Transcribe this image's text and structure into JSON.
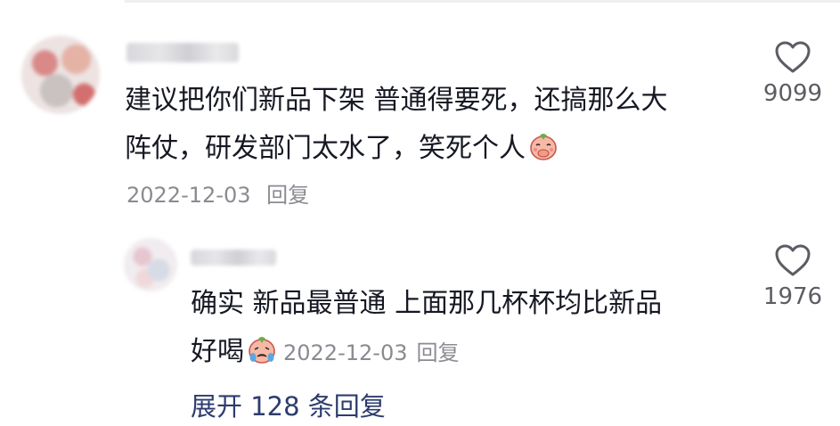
{
  "main_comment": {
    "text_line1": "建议把你们新品下架 普通得要死，还搞那么大",
    "text_line2": "阵仗，研发部门太水了，笑死个人",
    "emoji": "peach-covering-mouth-emoji",
    "date": "2022-12-03",
    "reply_label": "回复",
    "like_count": "9099"
  },
  "reply_comment": {
    "text_line1": "确实 新品最普通 上面那几杯杯均比新品",
    "text_line2": "好喝",
    "emoji": "peach-crying-emoji",
    "date": "2022-12-03",
    "reply_label": "回复",
    "like_count": "1976"
  },
  "expand_replies": {
    "label": "展开 128 条回复"
  },
  "colors": {
    "text": "#161823",
    "meta": "#8a8b91",
    "link": "#2d3c6e"
  }
}
